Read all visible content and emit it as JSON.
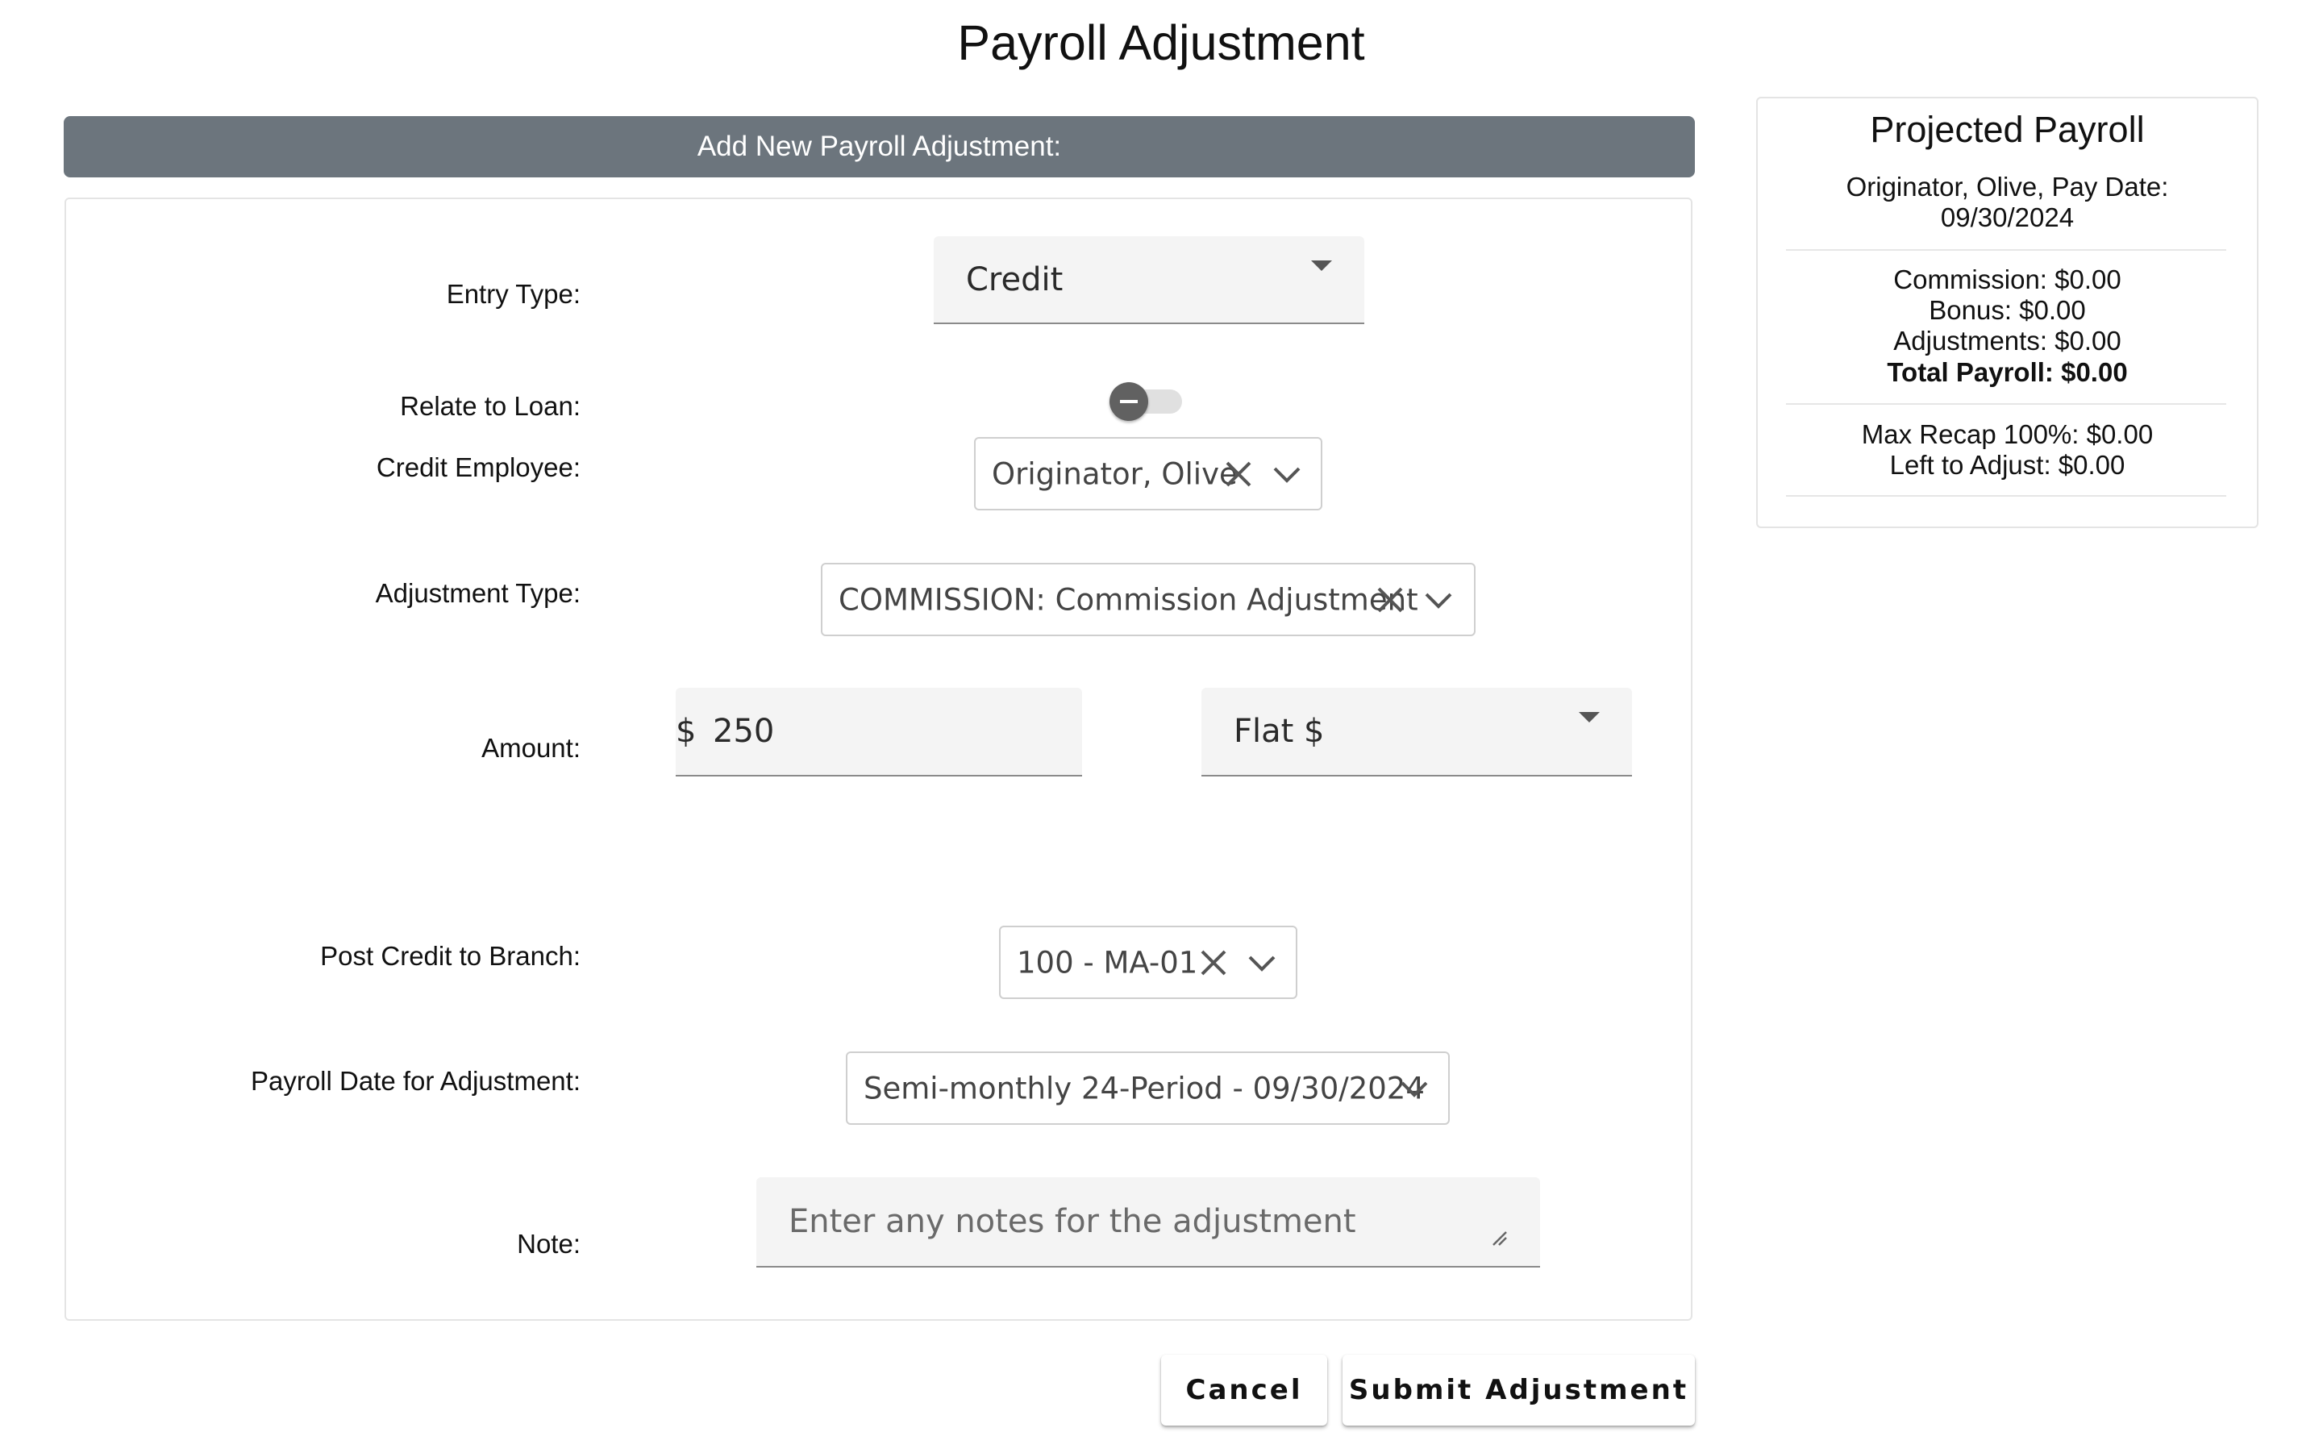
{
  "page": {
    "title": "Payroll Adjustment"
  },
  "form": {
    "header": "Add New Payroll Adjustment:",
    "entry_type": {
      "label": "Entry Type:",
      "value": "Credit"
    },
    "relate_to_loan": {
      "label": "Relate to Loan:",
      "checked": false
    },
    "credit_employee": {
      "label": "Credit Employee:",
      "value": "Originator, Olive"
    },
    "adjustment_type": {
      "label": "Adjustment Type:",
      "value": "COMMISSION: Commission Adjustment"
    },
    "amount": {
      "label": "Amount:",
      "prefix": "$",
      "value": "250",
      "unit": "Flat $"
    },
    "post_credit_branch": {
      "label": "Post Credit to Branch:",
      "value": "100 - MA-01"
    },
    "payroll_date": {
      "label": "Payroll Date for Adjustment:",
      "value": "Semi-monthly 24-Period - 09/30/2024"
    },
    "note": {
      "label": "Note:",
      "placeholder": "Enter any notes for the adjustment"
    }
  },
  "actions": {
    "cancel_label": "Cancel",
    "submit_label": "Submit Adjustment"
  },
  "summary": {
    "title": "Projected Payroll",
    "subtitle_line1": "Originator, Olive, Pay Date:",
    "subtitle_line2": "09/30/2024",
    "commission": "Commission: $0.00",
    "bonus": "Bonus: $0.00",
    "adjustments": "Adjustments: $0.00",
    "total": "Total Payroll: $0.00",
    "max_recap": "Max Recap 100%: $0.00",
    "left_to_adjust": "Left to Adjust: $0.00"
  },
  "icons": {
    "clear": "close-icon",
    "dropdown": "chevron-down-icon",
    "select": "caret-down-icon",
    "resize": "resize-handle-icon"
  },
  "colors": {
    "header_bg": "#6c757d",
    "toggle_knob": "#616161",
    "toggle_track": "#e0e0e0"
  }
}
